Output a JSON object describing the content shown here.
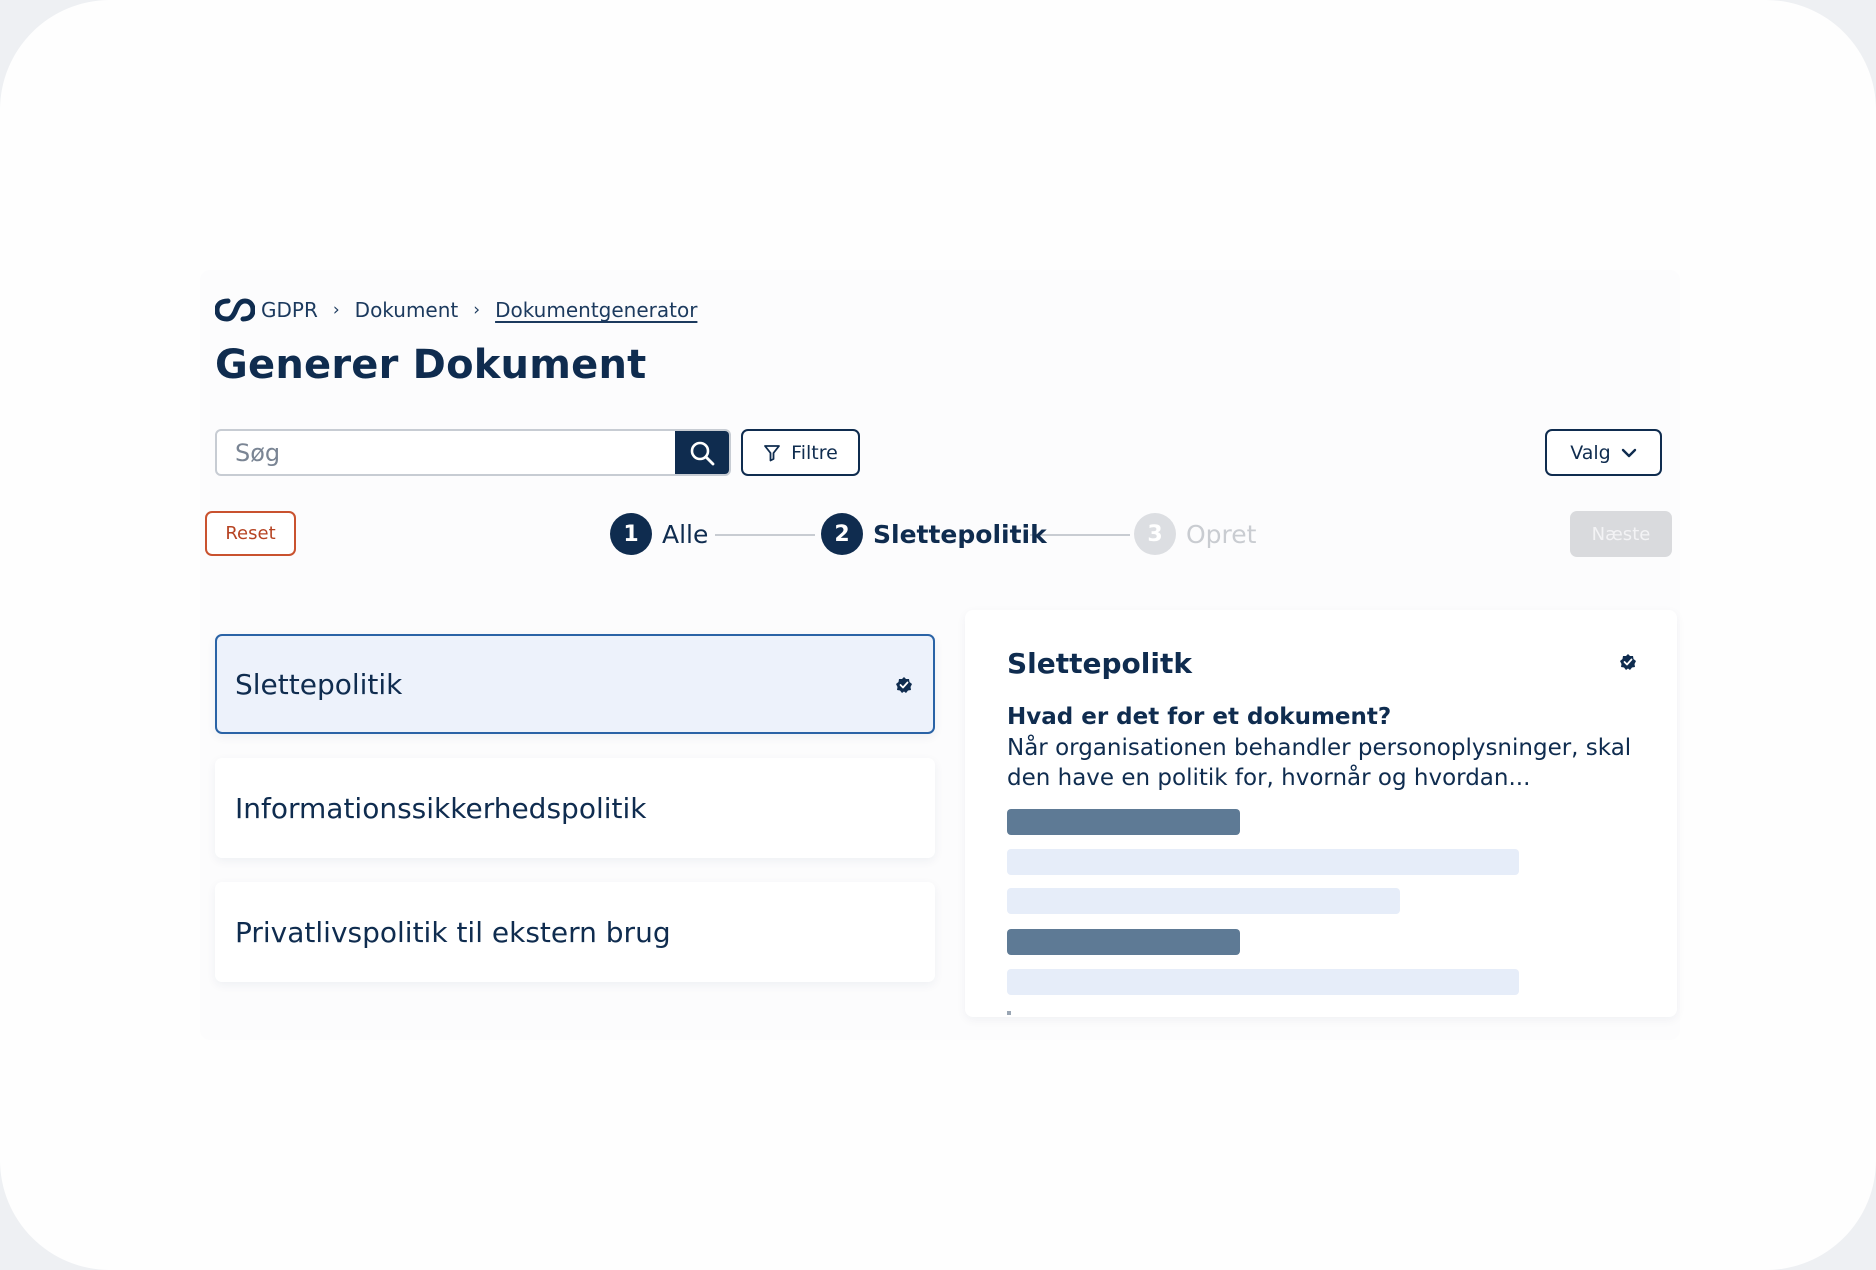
{
  "breadcrumb": {
    "items": [
      {
        "label": "GDPR"
      },
      {
        "label": "Dokument"
      },
      {
        "label": "Dokumentgenerator"
      }
    ],
    "separator": "›"
  },
  "page": {
    "title": "Generer Dokument"
  },
  "search": {
    "placeholder": "Søg",
    "value": ""
  },
  "toolbar": {
    "filter_label": "Filtre",
    "valg_label": "Valg",
    "reset_label": "Reset",
    "next_label": "Næste"
  },
  "stepper": {
    "steps": [
      {
        "number": "1",
        "label": "Alle",
        "state": "done"
      },
      {
        "number": "2",
        "label": "Slettepolitik",
        "state": "active"
      },
      {
        "number": "3",
        "label": "Opret",
        "state": "disabled"
      }
    ]
  },
  "documents": [
    {
      "title": "Slettepolitik",
      "selected": true
    },
    {
      "title": "Informationssikkerhedspolitik",
      "selected": false
    },
    {
      "title": "Privatlivspolitik til ekstern brug",
      "selected": false
    }
  ],
  "preview": {
    "title": "Slettepolitk",
    "question": "Hvad er det for et dokument?",
    "description": "Når organisationen behandler personoplysninger, skal den have en politik for, hvornår og hvordan..."
  },
  "colors": {
    "primary": "#0f2c4f",
    "accent_border": "#2a63a6",
    "reset": "#c9522f",
    "disabled": "#d9dadd"
  },
  "icons": {
    "logo": "chain-logo-icon",
    "search": "search-icon",
    "filter": "filter-icon",
    "dropdown": "chevron-down-icon",
    "badge": "verified-badge-icon"
  }
}
